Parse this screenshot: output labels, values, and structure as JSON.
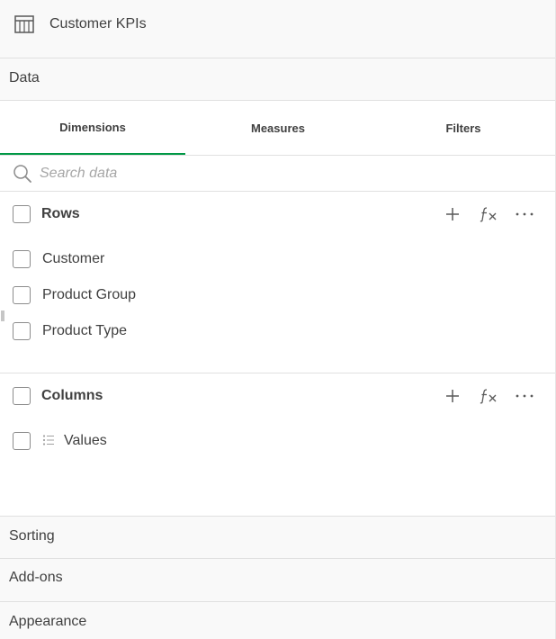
{
  "header": {
    "title": "Customer KPIs",
    "icon": "table-icon"
  },
  "data_section": {
    "label": "Data"
  },
  "tabs": [
    {
      "label": "Dimensions",
      "active": true
    },
    {
      "label": "Measures",
      "active": false
    },
    {
      "label": "Filters",
      "active": false
    }
  ],
  "search": {
    "placeholder": "Search data",
    "value": ""
  },
  "rows": {
    "title": "Rows",
    "items": [
      {
        "label": "Customer"
      },
      {
        "label": "Product Group"
      },
      {
        "label": "Product Type"
      }
    ]
  },
  "columns": {
    "title": "Columns",
    "items": [
      {
        "label": "Values",
        "icon": "list-icon"
      }
    ]
  },
  "bottom_sections": [
    {
      "label": "Sorting"
    },
    {
      "label": "Add-ons"
    },
    {
      "label": "Appearance"
    }
  ],
  "colors": {
    "accent": "#009845",
    "text": "#404040",
    "placeholder": "#a6a6a6",
    "section_bg": "#f9f9f9",
    "border": "#e0e0e0"
  }
}
